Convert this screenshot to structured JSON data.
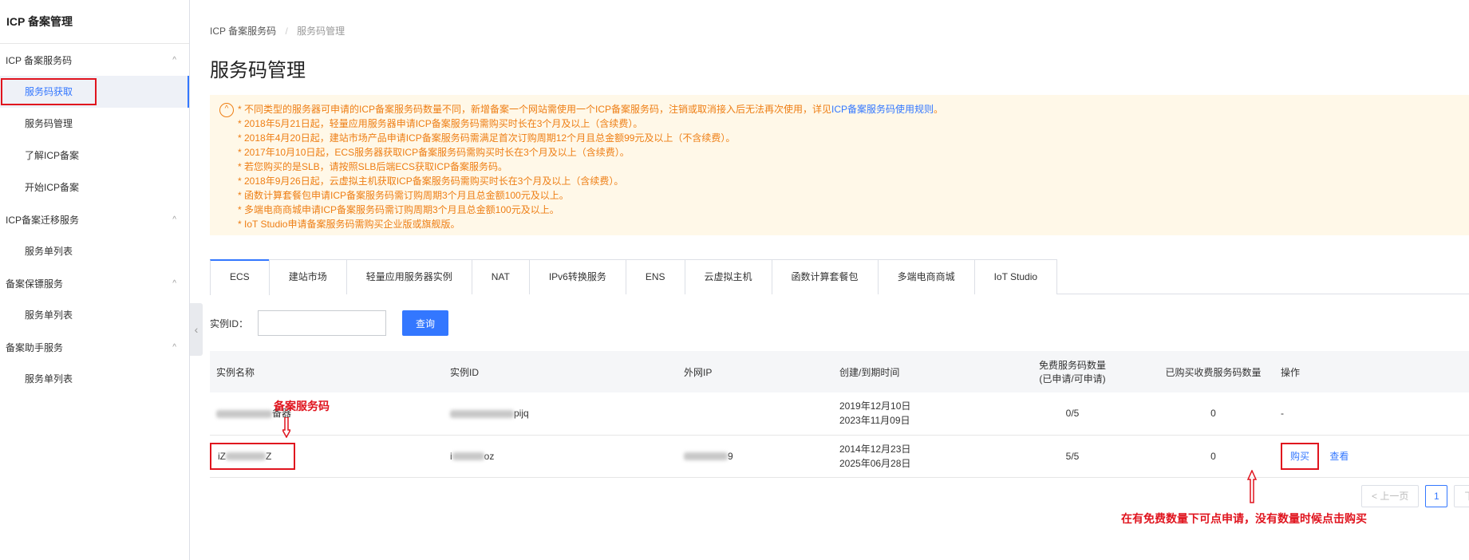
{
  "sidebar": {
    "title": "ICP 备案管理",
    "groups": [
      {
        "label": "ICP 备案服务码",
        "items": [
          "服务码获取",
          "服务码管理",
          "了解ICP备案",
          "开始ICP备案"
        ]
      },
      {
        "label": "ICP备案迁移服务",
        "items": [
          "服务单列表"
        ]
      },
      {
        "label": "备案保镖服务",
        "items": [
          "服务单列表"
        ]
      },
      {
        "label": "备案助手服务",
        "items": [
          "服务单列表"
        ]
      }
    ],
    "collapse_glyph": "‹",
    "chevron_glyph": "^"
  },
  "breadcrumb": {
    "parent": "ICP 备案服务码",
    "sep": "/",
    "current": "服务码管理"
  },
  "page_title": "服务码管理",
  "notice": {
    "icon_glyph": "^",
    "line1_prefix": "* 不同类型的服务器可申请的ICP备案服务码数量不同，新增备案一个网站需使用一个ICP备案服务码，注销或取消接入后无法再次使用，详见",
    "line1_link": "ICP备案服务码使用规则",
    "line1_suffix": "。",
    "lines": [
      "* 2018年5月21日起，轻量应用服务器申请ICP备案服务码需购买时长在3个月及以上（含续费）。",
      "* 2018年4月20日起，建站市场产品申请ICP备案服务码需满足首次订购周期12个月且总金额99元及以上（不含续费）。",
      "* 2017年10月10日起，ECS服务器获取ICP备案服务码需购买时长在3个月及以上（含续费）。",
      "* 若您购买的是SLB，请按照SLB后端ECS获取ICP备案服务码。",
      "* 2018年9月26日起，云虚拟主机获取ICP备案服务码需购买时长在3个月及以上（含续费）。",
      "* 函数计算套餐包申请ICP备案服务码需订购周期3个月且总金额100元及以上。",
      "* 多端电商商城申请ICP备案服务码需订购周期3个月且总金额100元及以上。",
      "* IoT Studio申请备案服务码需购买企业版或旗舰版。"
    ]
  },
  "tabs": [
    "ECS",
    "建站市场",
    "轻量应用服务器实例",
    "NAT",
    "IPv6转换服务",
    "ENS",
    "云虚拟主机",
    "函数计算套餐包",
    "多端电商商城",
    "IoT Studio"
  ],
  "filter": {
    "label": "实例ID：",
    "placeholder": "",
    "button": "查询"
  },
  "table": {
    "headers": [
      "实例名称",
      "实例ID",
      "外网IP",
      "创建/到期时间",
      "免费服务码数量",
      "(已申请/可申请)",
      "已购买收费服务码数量",
      "操作"
    ],
    "rows": [
      {
        "name_suffix": "备器",
        "id_suffix": "pijq",
        "ip": "",
        "created": "2019年12月10日",
        "expires": "2023年11月09日",
        "free": "0/5",
        "paid": "0",
        "action": "-"
      },
      {
        "name_prefix": "iZ",
        "name_suffix": "Z",
        "id_prefix": "i",
        "id_suffix": "oz",
        "ip_suffix": "9",
        "created": "2014年12月23日",
        "expires": "2025年06月28日",
        "free": "5/5",
        "paid": "0",
        "buy": "购买",
        "view": "查看"
      }
    ]
  },
  "pagination": {
    "prev": "< 上一页",
    "page": "1",
    "next": "下一"
  },
  "annotations": {
    "code_label": "备案服务码",
    "hint": "在有免费数量下可点申请，没有数量时候点击购买"
  },
  "colors": {
    "accent": "#3377ff",
    "warning_text": "#ee7e14",
    "warning_bg": "#fff8e8",
    "annotation": "#e0141e"
  }
}
